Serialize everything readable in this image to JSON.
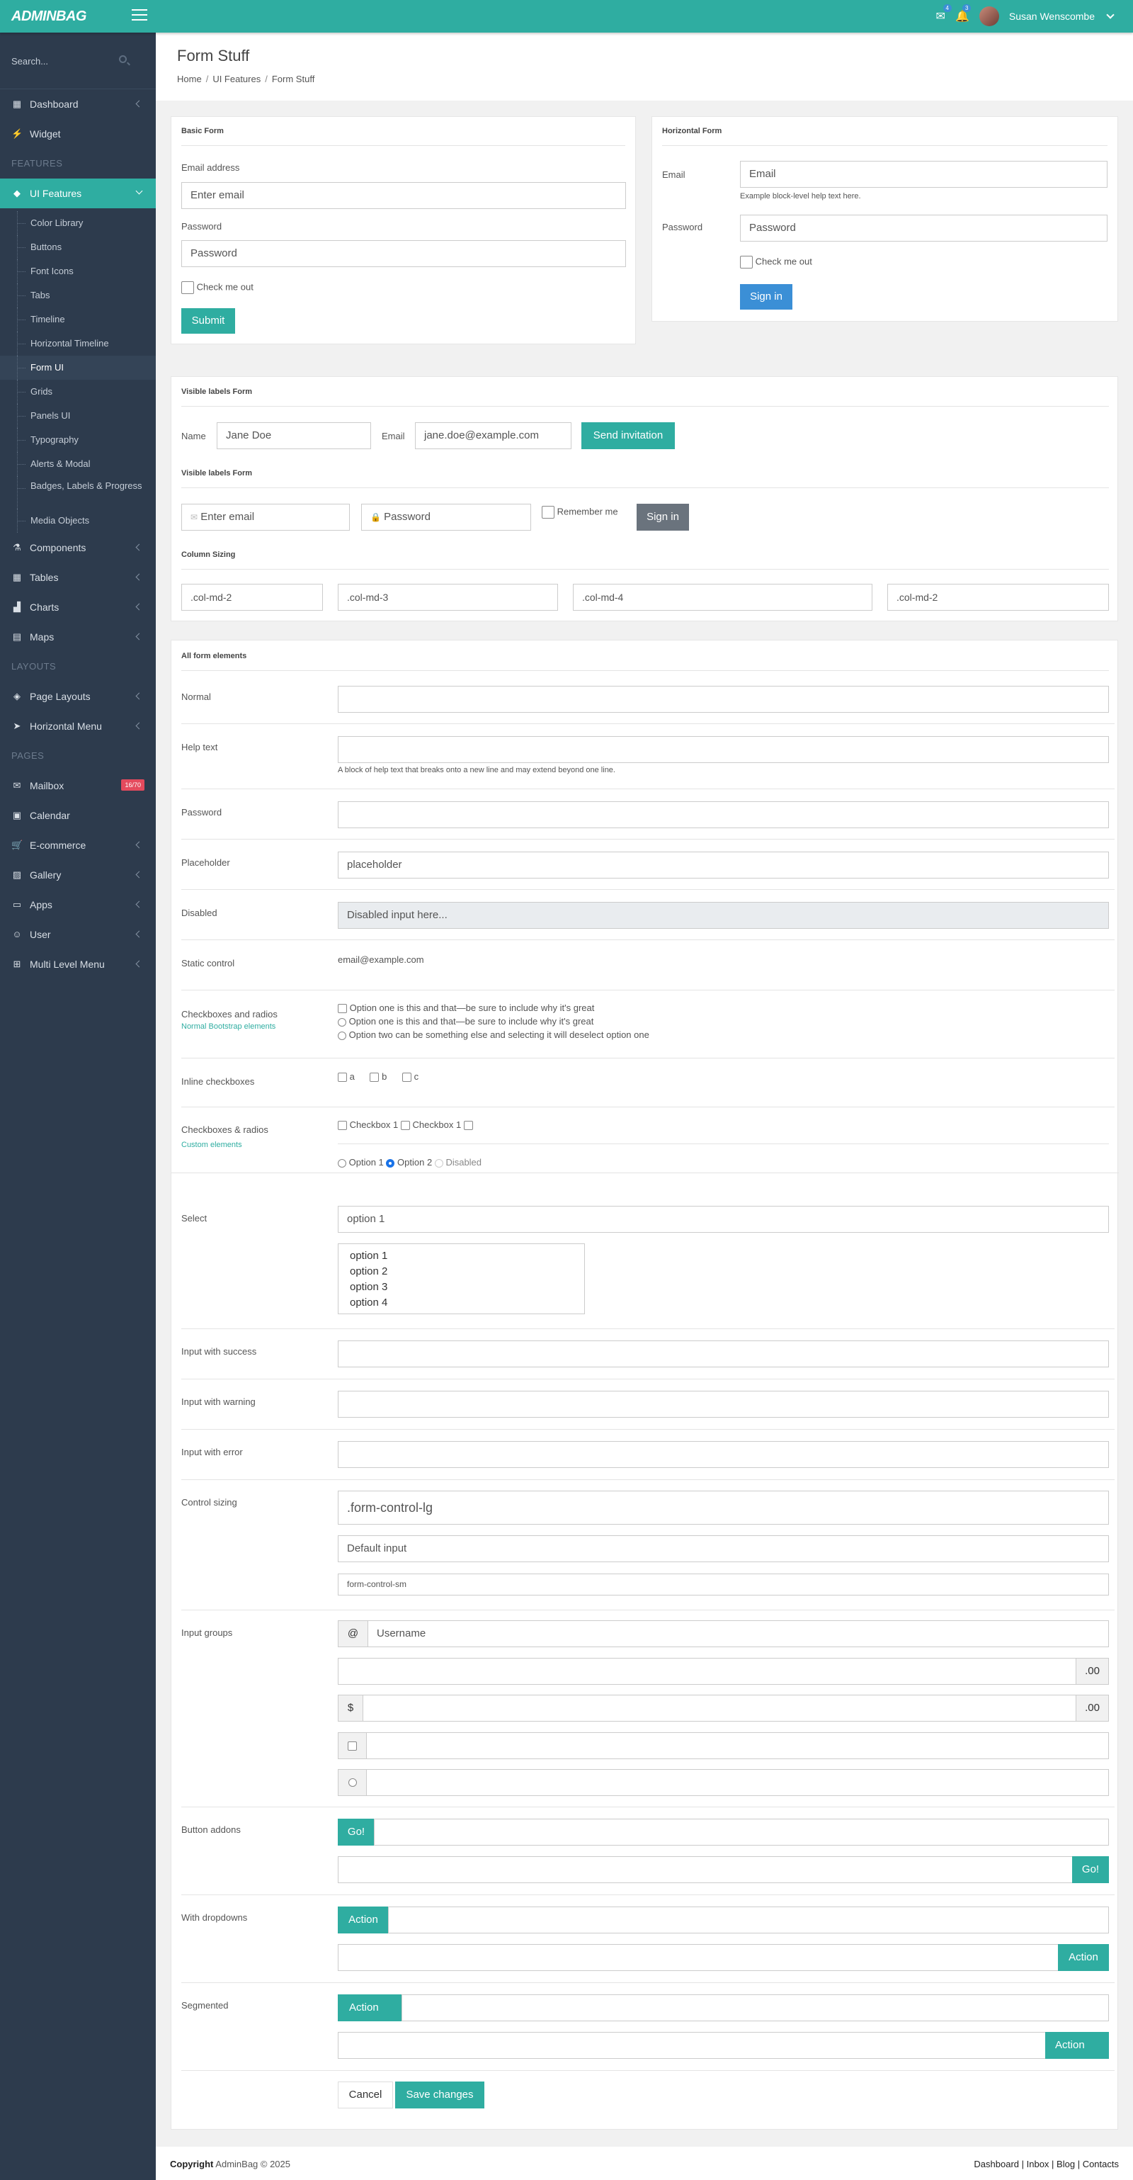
{
  "app": {
    "logo": "ADMINBAG",
    "mail_count": "4",
    "bell_count": "3",
    "user": "Susan Wenscombe"
  },
  "sidebar": {
    "search_placeholder": "Search...",
    "items": [
      {
        "label": "Dashboard",
        "icon": "table-icon",
        "arrow": true
      },
      {
        "label": "Widget",
        "icon": "bolt-icon",
        "arrow": false
      }
    ],
    "features_head": "FEATURES",
    "ui_features": "UI Features",
    "sub": [
      "Color Library",
      "Buttons",
      "Font Icons",
      "Tabs",
      "Timeline",
      "Horizontal Timeline",
      "Form UI",
      "Grids",
      "Panels UI",
      "Typography",
      "Alerts & Modal",
      "Badges, Labels & Progress",
      "Media Objects"
    ],
    "items2": [
      {
        "label": "Components"
      },
      {
        "label": "Tables"
      },
      {
        "label": "Charts"
      },
      {
        "label": "Maps"
      }
    ],
    "layouts_head": "LAYOUTS",
    "items3": [
      {
        "label": "Page Layouts"
      },
      {
        "label": "Horizontal Menu"
      }
    ],
    "pages_head": "PAGES",
    "mailbox": "Mailbox",
    "mailbox_badge": "16/70",
    "items4": [
      {
        "label": "Calendar"
      },
      {
        "label": "E-commerce"
      },
      {
        "label": "Gallery"
      },
      {
        "label": "Apps"
      },
      {
        "label": "User"
      },
      {
        "label": "Multi Level Menu"
      }
    ]
  },
  "page": {
    "title": "Form Stuff",
    "crumbs": [
      "Home",
      "UI Features",
      "Form Stuff"
    ]
  },
  "basic": {
    "title": "Basic Form",
    "email_label": "Email address",
    "email_ph": "Enter email",
    "pass_label": "Password",
    "pass_ph": "Password",
    "check": "Check me out",
    "submit": "Submit"
  },
  "horizontal": {
    "title": "Horizontal Form",
    "email_label": "Email",
    "email_ph": "Email",
    "help": "Example block-level help text here.",
    "pass_label": "Password",
    "pass_ph": "Password",
    "check": "Check me out",
    "signin": "Sign in"
  },
  "visible": {
    "title": "Visible labels Form",
    "name_label": "Name",
    "name_value": "Jane Doe",
    "email_label": "Email",
    "email_value": "jane.doe@example.com",
    "invite": "Send invitation",
    "title2": "Visible labels Form",
    "email_ph": "Enter email",
    "pass_ph": "Password",
    "remember": "Remember me",
    "signin": "Sign in",
    "title3": "Column Sizing",
    "cols": [
      ".col-md-2",
      ".col-md-3",
      ".col-md-4",
      ".col-md-2"
    ]
  },
  "all": {
    "title": "All form elements",
    "normal": "Normal",
    "help_text": "Help text",
    "help_desc": "A block of help text that breaks onto a new line and may extend beyond one line.",
    "password": "Password",
    "placeholder": "Placeholder",
    "placeholder_value": "placeholder",
    "disabled": "Disabled",
    "disabled_value": "Disabled input here...",
    "static": "Static control",
    "static_value": "email@example.com",
    "checks": "Checkboxes and radios",
    "checks_sub": "Normal Bootstrap elements",
    "check_opts": [
      "Option one is this and that—be sure to include why it's great",
      "Option one is this and that—be sure to include why it's great",
      "Option two can be something else and selecting it will deselect option one"
    ],
    "inline": "Inline checkboxes",
    "inline_opts": [
      "a",
      "b",
      "c"
    ],
    "custom": "Checkboxes & radios",
    "custom_sub": "Custom elements",
    "custom_checks": [
      "Checkbox 1",
      "Checkbox 1"
    ],
    "custom_radios": [
      "Option 1",
      "Option 2",
      "Disabled"
    ],
    "select": "Select",
    "select_value": "option 1",
    "multi": [
      "option 1",
      "option 2",
      "option 3",
      "option 4"
    ],
    "success": "Input with success",
    "warning": "Input with warning",
    "error": "Input with error",
    "sizing": "Control sizing",
    "lg": ".form-control-lg",
    "def": "Default input",
    "sm": "form-control-sm",
    "groups": "Input groups",
    "at": "@",
    "username": "Username",
    "dec": ".00",
    "dollar": "$",
    "addons": "Button addons",
    "go": "Go!",
    "dropdowns": "With dropdowns",
    "action": "Action",
    "segmented": "Segmented",
    "cancel": "Cancel",
    "save": "Save changes"
  },
  "footer": {
    "copyright": "Copyright",
    "brand": "AdminBag © 2025",
    "links": [
      "Dashboard",
      "Inbox",
      "Blog",
      "Contacts"
    ]
  }
}
